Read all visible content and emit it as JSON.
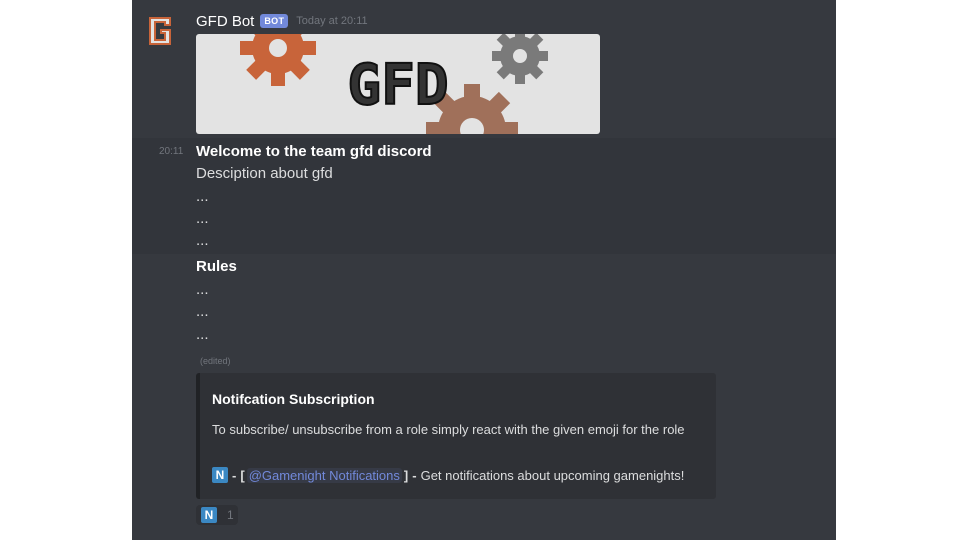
{
  "message": {
    "author": "GFD Bot",
    "badge": "BOT",
    "timestamp": "Today at 20:11",
    "compact_time": "20:11",
    "banner_text": "GFD",
    "welcome_title": "Welcome to the team gfd discord",
    "description": "Desciption about gfd",
    "ellipsis": "...",
    "rules_title": "Rules",
    "edited": "(edited)"
  },
  "embed": {
    "title": "Notifcation Subscription",
    "description": "To subscribe/ unsubscribe from a role simply react with the given emoji for the role",
    "role_entry": {
      "emoji": "N",
      "separator": "-",
      "open_bracket": "[",
      "mention": "@Gamenight Notifications",
      "close_bracket": "]",
      "text": "Get notifications about upcoming gamenights!"
    }
  },
  "reaction": {
    "emoji": "N",
    "count": "1"
  },
  "colors": {
    "background": "#36393f",
    "mention": "#7289da",
    "badge": "#7289da",
    "emoji": "#3b88c3",
    "gear_orange": "#c8643a",
    "gear_gray": "#7a7a7a"
  }
}
